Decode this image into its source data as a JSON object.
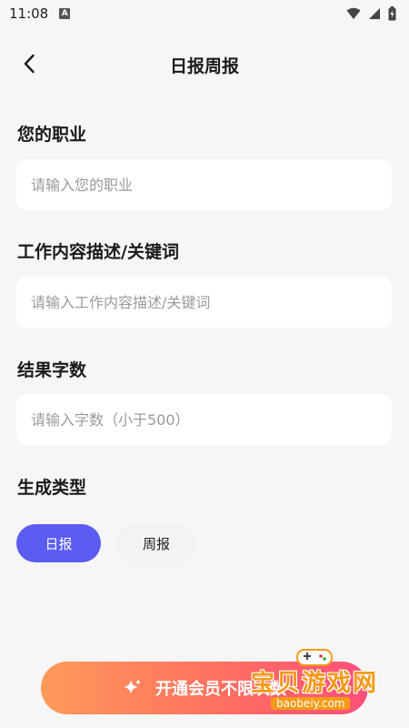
{
  "status_bar": {
    "time": "11:08",
    "notification_letter": "A"
  },
  "header": {
    "title": "日报周报"
  },
  "form": {
    "occupation": {
      "label": "您的职业",
      "placeholder": "请输入您的职业"
    },
    "description": {
      "label": "工作内容描述/关键词",
      "placeholder": "请输入工作内容描述/关键词"
    },
    "word_count": {
      "label": "结果字数",
      "placeholder": "请输入字数（小于500）"
    },
    "type": {
      "label": "生成类型",
      "options": [
        "日报",
        "周报"
      ],
      "selected": "日报"
    }
  },
  "vip_button": {
    "label": "开通会员不限次数"
  },
  "watermark": {
    "text": "宝贝游戏网",
    "url": "baobeiy.com"
  },
  "colors": {
    "accent": "#5b5cf2",
    "vip_gradient": [
      "#ff9a5a",
      "#ff4f7a"
    ],
    "watermark": "#f59a16"
  }
}
